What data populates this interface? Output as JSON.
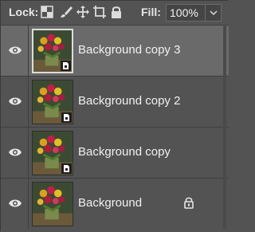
{
  "toolbar": {
    "lock_label": "Lock:",
    "lock_icons": [
      "lock-transparent-pixels-icon",
      "lock-image-pixels-icon",
      "lock-position-icon",
      "prevent-auto-nesting-icon",
      "lock-all-icon"
    ],
    "fill_label": "Fill:",
    "fill_value": "100%"
  },
  "layers": [
    {
      "name": "Background copy 3",
      "selected": true,
      "smart_object": true,
      "locked": false,
      "visible": true
    },
    {
      "name": "Background copy 2",
      "selected": false,
      "smart_object": true,
      "locked": false,
      "visible": true
    },
    {
      "name": "Background copy",
      "selected": false,
      "smart_object": true,
      "locked": false,
      "visible": true
    },
    {
      "name": "Background",
      "selected": false,
      "smart_object": false,
      "locked": true,
      "visible": true
    }
  ],
  "colors": {
    "panel_bg": "#535353",
    "selected_row_bg": "#6a6a6a",
    "text": "#f0f0f0"
  }
}
